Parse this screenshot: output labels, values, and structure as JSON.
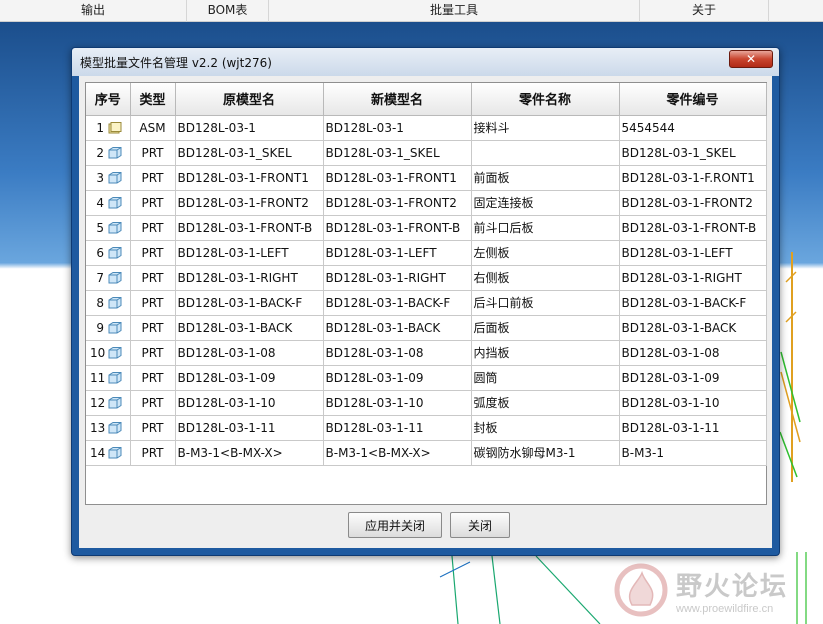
{
  "menubar": {
    "items": [
      {
        "label": "输出"
      },
      {
        "label": "BOM表"
      },
      {
        "label": "批量工具"
      },
      {
        "label": "关于"
      }
    ]
  },
  "watermark": {
    "title": "野火论坛",
    "url": "www.proewildfire.cn"
  },
  "dialog": {
    "title": "模型批量文件名管理  v2.2 (wjt276)",
    "close_icon": "close-icon"
  },
  "table": {
    "headers": [
      "序号",
      "类型",
      "原模型名",
      "新模型名",
      "零件名称",
      "零件编号"
    ],
    "rows": [
      {
        "seq": "1",
        "icon": "assembly-icon",
        "type": "ASM",
        "orig": "BD128L-03-1",
        "new": "BD128L-03-1",
        "part_name": "接料斗",
        "part_no": "5454544"
      },
      {
        "seq": "2",
        "icon": "part-icon",
        "type": "PRT",
        "orig": "BD128L-03-1_SKEL",
        "new": "BD128L-03-1_SKEL",
        "part_name": "",
        "part_no": "BD128L-03-1_SKEL"
      },
      {
        "seq": "3",
        "icon": "part-icon",
        "type": "PRT",
        "orig": "BD128L-03-1-FRONT1",
        "new": "BD128L-03-1-FRONT1",
        "part_name": "前面板",
        "part_no": "BD128L-03-1-F.RONT1"
      },
      {
        "seq": "4",
        "icon": "part-icon",
        "type": "PRT",
        "orig": "BD128L-03-1-FRONT2",
        "new": "BD128L-03-1-FRONT2",
        "part_name": "固定连接板",
        "part_no": "BD128L-03-1-FRONT2"
      },
      {
        "seq": "5",
        "icon": "part-icon",
        "type": "PRT",
        "orig": "BD128L-03-1-FRONT-B",
        "new": "BD128L-03-1-FRONT-B",
        "part_name": "前斗口后板",
        "part_no": "BD128L-03-1-FRONT-B"
      },
      {
        "seq": "6",
        "icon": "part-icon",
        "type": "PRT",
        "orig": "BD128L-03-1-LEFT",
        "new": "BD128L-03-1-LEFT",
        "part_name": "左侧板",
        "part_no": "BD128L-03-1-LEFT"
      },
      {
        "seq": "7",
        "icon": "part-icon",
        "type": "PRT",
        "orig": "BD128L-03-1-RIGHT",
        "new": "BD128L-03-1-RIGHT",
        "part_name": "右侧板",
        "part_no": "BD128L-03-1-RIGHT"
      },
      {
        "seq": "8",
        "icon": "part-icon",
        "type": "PRT",
        "orig": "BD128L-03-1-BACK-F",
        "new": "BD128L-03-1-BACK-F",
        "part_name": "后斗口前板",
        "part_no": "BD128L-03-1-BACK-F"
      },
      {
        "seq": "9",
        "icon": "part-icon",
        "type": "PRT",
        "orig": "BD128L-03-1-BACK",
        "new": "BD128L-03-1-BACK",
        "part_name": "后面板",
        "part_no": "BD128L-03-1-BACK"
      },
      {
        "seq": "10",
        "icon": "part-icon",
        "type": "PRT",
        "orig": "BD128L-03-1-08",
        "new": "BD128L-03-1-08",
        "part_name": "内挡板",
        "part_no": "BD128L-03-1-08"
      },
      {
        "seq": "11",
        "icon": "part-icon",
        "type": "PRT",
        "orig": "BD128L-03-1-09",
        "new": "BD128L-03-1-09",
        "part_name": "圆筒",
        "part_no": "BD128L-03-1-09"
      },
      {
        "seq": "12",
        "icon": "part-icon",
        "type": "PRT",
        "orig": "BD128L-03-1-10",
        "new": "BD128L-03-1-10",
        "part_name": "弧度板",
        "part_no": "BD128L-03-1-10"
      },
      {
        "seq": "13",
        "icon": "part-icon",
        "type": "PRT",
        "orig": "BD128L-03-1-11",
        "new": "BD128L-03-1-11",
        "part_name": "封板",
        "part_no": "BD128L-03-1-11"
      },
      {
        "seq": "14",
        "icon": "part-icon",
        "type": "PRT",
        "orig": "B-M3-1<B-MX-X>",
        "new": "B-M3-1<B-MX-X>",
        "part_name": "碳钢防水铆母M3-1",
        "part_no": "B-M3-1"
      }
    ]
  },
  "buttons": {
    "apply_close": "应用并关闭",
    "close": "关闭"
  },
  "colors": {
    "titlebar": "#d5e1ef",
    "dialog_frame": "#1e5aa0",
    "close_button": "#c9452f",
    "cad_background_top": "#1b4e8c"
  }
}
